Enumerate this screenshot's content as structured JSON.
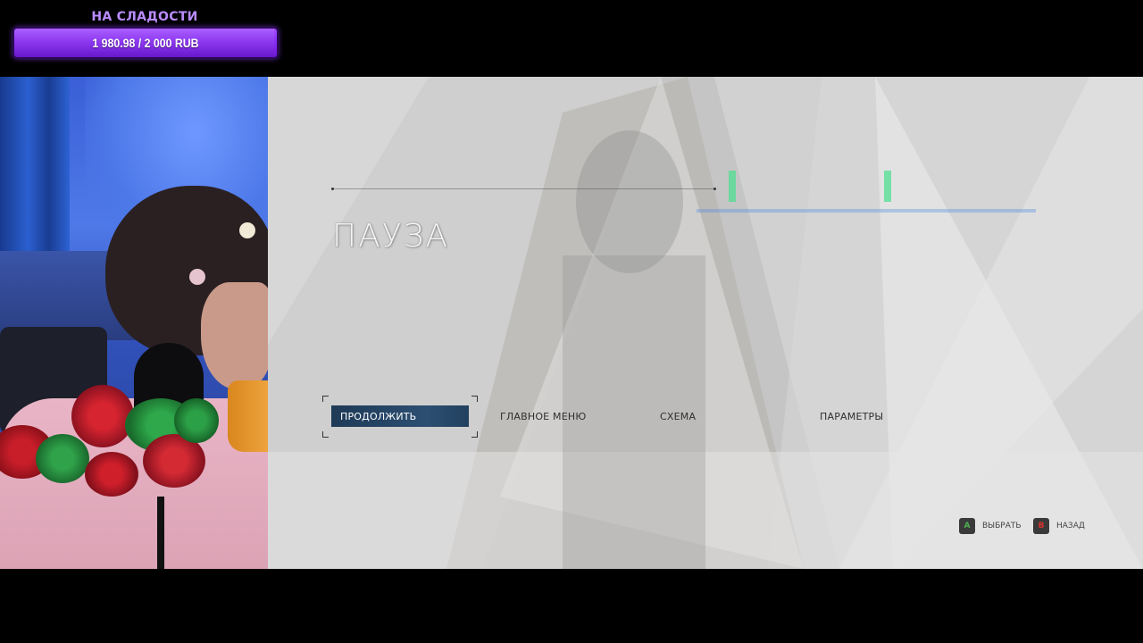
{
  "goal": {
    "title": "НА СЛАДОСТИ",
    "amount_text": "1 980.98 / 2 000 RUB",
    "raised": 1980.98,
    "target": 2000,
    "currency": "RUB"
  },
  "game": {
    "pause_title": "ПАУЗА",
    "menu": [
      {
        "label": "ПРОДОЛЖИТЬ",
        "selected": true
      },
      {
        "label": "ГЛАВНОЕ МЕНЮ",
        "selected": false
      },
      {
        "label": "СХЕМА",
        "selected": false
      },
      {
        "label": "ПАРАМЕТРЫ",
        "selected": false
      }
    ],
    "hints": {
      "select": {
        "glyph": "A",
        "label": "ВЫБРАТЬ",
        "color": "#4caf50"
      },
      "back": {
        "glyph": "B",
        "label": "НАЗАД",
        "color": "#d9342b"
      }
    }
  },
  "colors": {
    "goal_accent": "#8a2ef5",
    "menu_selected": "#2c4f72"
  }
}
